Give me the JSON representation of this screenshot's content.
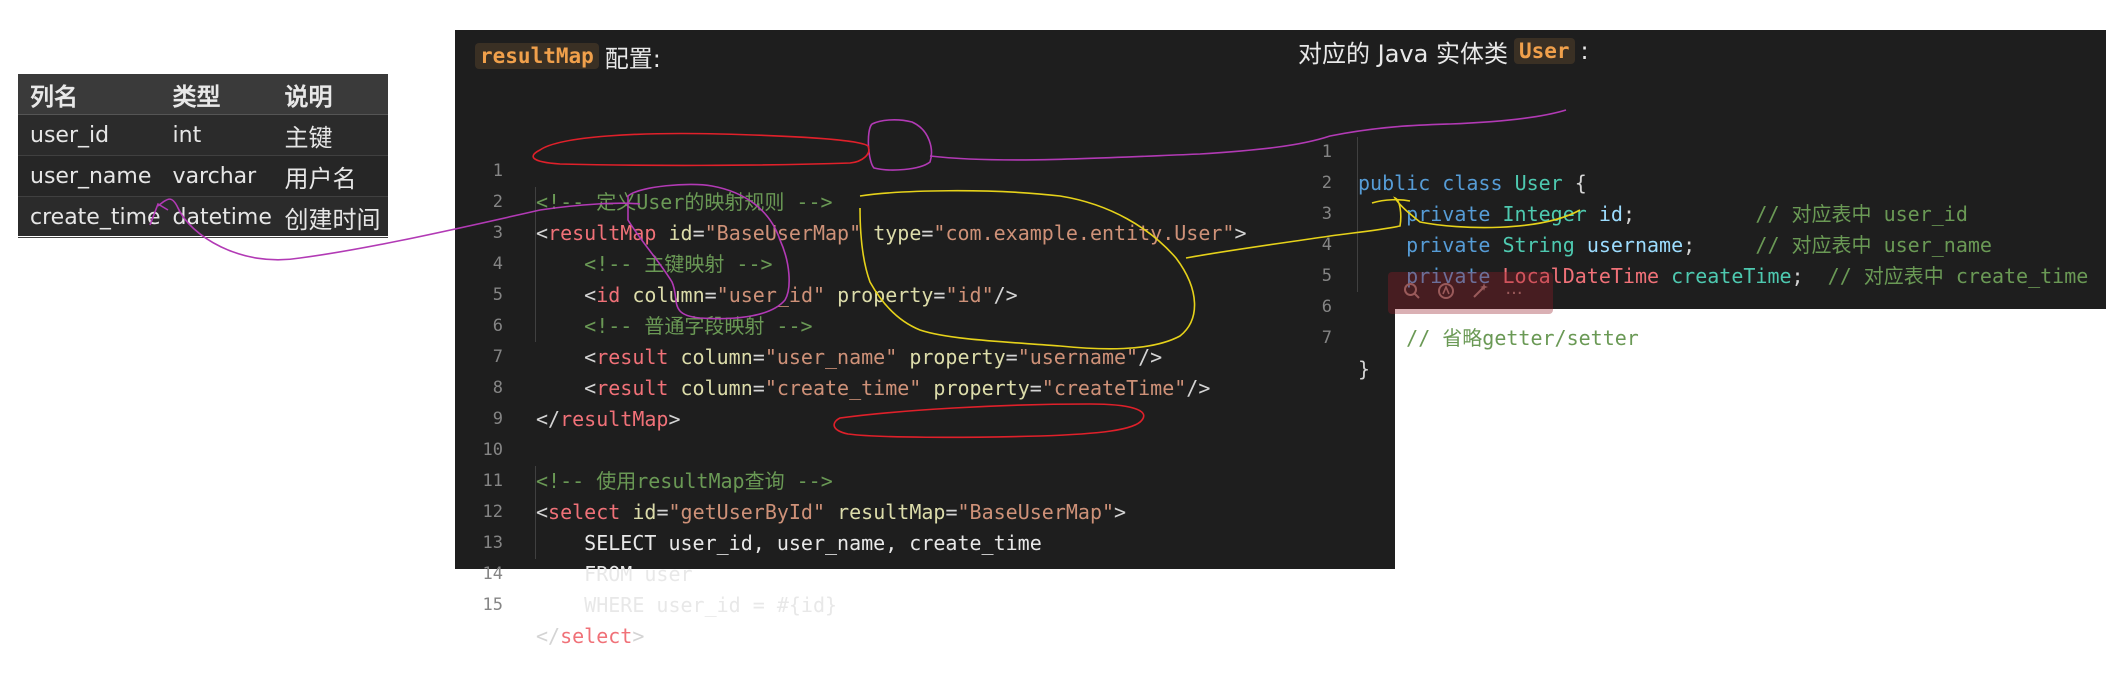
{
  "table": {
    "headers": [
      "列名",
      "类型",
      "说明"
    ],
    "rows": [
      [
        "user_id",
        "int",
        "主键"
      ],
      [
        "user_name",
        "varchar",
        "用户名"
      ],
      [
        "create_time",
        "datetime",
        "创建时间"
      ]
    ]
  },
  "xml_panel": {
    "chip": "resultMap",
    "title": "配置:",
    "lines": [
      {
        "n": "1"
      },
      {
        "n": "2"
      },
      {
        "n": "3"
      },
      {
        "n": "4"
      },
      {
        "n": "5"
      },
      {
        "n": "6"
      },
      {
        "n": "7"
      },
      {
        "n": "8"
      },
      {
        "n": "9"
      },
      {
        "n": "10"
      },
      {
        "n": "11"
      },
      {
        "n": "12"
      },
      {
        "n": "13"
      },
      {
        "n": "14"
      },
      {
        "n": "15"
      }
    ],
    "code": {
      "l1_comment": "<!-- 定义User的映射规则 -->",
      "l2_open": "<",
      "l2_tag": "resultMap",
      "l2_attr1": "id",
      "l2_val1": "\"BaseUserMap\"",
      "l2_attr2": "type",
      "l2_val2": "\"com.example.entity.User\"",
      "l2_close": ">",
      "l3_comment": "<!-- 主键映射 -->",
      "l4_tag": "id",
      "l4_attr1": "column",
      "l4_val1": "\"user_id\"",
      "l4_attr2": "property",
      "l4_val2": "\"id\"",
      "l4_close": "/>",
      "l5_comment": "<!-- 普通字段映射 -->",
      "l6_tag": "result",
      "l6_attr1": "column",
      "l6_val1": "\"user_name\"",
      "l6_attr2": "property",
      "l6_val2": "\"username\"",
      "l6_close": "/>",
      "l7_tag": "result",
      "l7_attr1": "column",
      "l7_val1": "\"create_time\"",
      "l7_attr2": "property",
      "l7_val2": "\"createTime\"",
      "l7_close": "/>",
      "l8_open": "</",
      "l8_tag": "resultMap",
      "l8_close": ">",
      "l10_comment": "<!-- 使用resultMap查询 -->",
      "l11_tag": "select",
      "l11_attr1": "id",
      "l11_val1": "\"getUserById\"",
      "l11_attr2": "resultMap",
      "l11_val2": "\"BaseUserMap\"",
      "l11_close": ">",
      "l12_sql": "SELECT user_id, user_name, create_time",
      "l13_sql": "FROM user",
      "l14_sql": "WHERE user_id = #{id}",
      "l15_open": "</",
      "l15_tag": "select",
      "l15_close": ">"
    }
  },
  "java_panel": {
    "title_prefix": "对应的 Java 实体类",
    "chip": "User",
    "title_suffix": ":",
    "lines": [
      {
        "n": "1"
      },
      {
        "n": "2"
      },
      {
        "n": "3"
      },
      {
        "n": "4"
      },
      {
        "n": "5"
      },
      {
        "n": "6"
      },
      {
        "n": "7"
      }
    ],
    "code": {
      "l1_kw1": "public",
      "l1_kw2": "class",
      "l1_name": "User",
      "l1_brace": "{",
      "l2_kw": "private",
      "l2_type": "Integer",
      "l2_var": "id",
      "l2_semi": ";",
      "l2_comment": "// 对应表中 user_id",
      "l3_kw": "private",
      "l3_type": "String",
      "l3_var": "username",
      "l3_semi": ";",
      "l3_comment": "// 对应表中 user_name",
      "l4_kw": "private",
      "l4_type": "LocalDateTime",
      "l4_var": "createTime",
      "l4_semi": ";",
      "l4_comment": "// 对应表中 create_time",
      "l6_comment": "// 省略getter/setter",
      "l7_brace": "}"
    }
  },
  "toolbar": {
    "icons": [
      "search-icon",
      "ai-icon",
      "magic-wand-icon",
      "more-icon"
    ],
    "more_label": "···"
  },
  "colors": {
    "annotation_purple": "#b23ab5",
    "annotation_yellow": "#e6d21a",
    "annotation_red": "#e0202a",
    "editor_bg": "#1e1e1e"
  }
}
